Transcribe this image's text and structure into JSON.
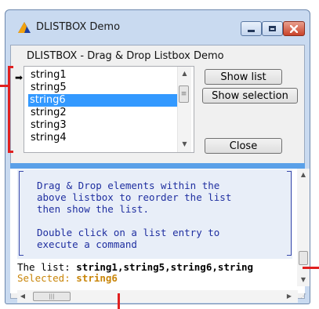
{
  "window": {
    "title": "DLISTBOX Demo",
    "controls": {
      "minimize_icon": "minimize-icon",
      "maximize_icon": "maximize-icon",
      "close_icon": "close-icon"
    }
  },
  "dialog": {
    "heading": "DLISTBOX - Drag & Drop Listbox Demo"
  },
  "listbox": {
    "items": [
      "string1",
      "string5",
      "string6",
      "string2",
      "string3",
      "string4"
    ],
    "selected_index": 2,
    "selection_color": "#3399ff"
  },
  "buttons": {
    "show_list": "Show list",
    "show_selection": "Show selection",
    "close": "Close"
  },
  "console": {
    "message_lines": [
      "Drag & Drop elements within the",
      "above listbox to reorder the list",
      "then show the list.",
      "",
      "Double click on a list entry to",
      "execute a command"
    ],
    "list_prefix": "The list: ",
    "list_value": "string1,string5,string6,string",
    "selected_prefix": "Selected: ",
    "selected_value": "string6",
    "text_color": "#1f2fa0",
    "selected_color": "#c9860a"
  },
  "colors": {
    "annotation_red": "#e02020"
  }
}
